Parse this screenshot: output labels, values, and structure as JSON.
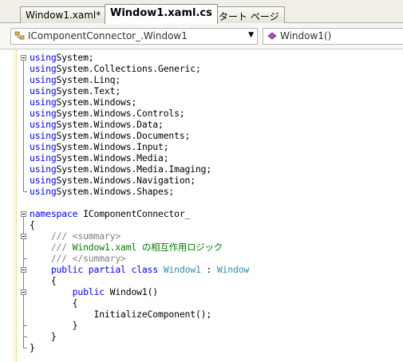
{
  "tabs": [
    {
      "label": "Window1.xaml*",
      "active": false
    },
    {
      "label": "Window1.xaml.cs",
      "active": true
    },
    {
      "label": "スタート ページ",
      "active": false
    }
  ],
  "nav": {
    "class_combo": "IComponentConnector_.Window1",
    "member_combo": "Window1()"
  },
  "code": [
    [
      [
        "kw",
        "using"
      ],
      [
        "",
        "System;"
      ]
    ],
    [
      [
        "kw",
        "using"
      ],
      [
        "",
        "System.Collections.Generic;"
      ]
    ],
    [
      [
        "kw",
        "using"
      ],
      [
        "",
        "System.Linq;"
      ]
    ],
    [
      [
        "kw",
        "using"
      ],
      [
        "",
        "System.Text;"
      ]
    ],
    [
      [
        "kw",
        "using"
      ],
      [
        "",
        "System.Windows;"
      ]
    ],
    [
      [
        "kw",
        "using"
      ],
      [
        "",
        "System.Windows.Controls;"
      ]
    ],
    [
      [
        "kw",
        "using"
      ],
      [
        "",
        "System.Windows.Data;"
      ]
    ],
    [
      [
        "kw",
        "using"
      ],
      [
        "",
        "System.Windows.Documents;"
      ]
    ],
    [
      [
        "kw",
        "using"
      ],
      [
        "",
        "System.Windows.Input;"
      ]
    ],
    [
      [
        "kw",
        "using"
      ],
      [
        "",
        "System.Windows.Media;"
      ]
    ],
    [
      [
        "kw",
        "using"
      ],
      [
        "",
        "System.Windows.Media.Imaging;"
      ]
    ],
    [
      [
        "kw",
        "using"
      ],
      [
        "",
        "System.Windows.Navigation;"
      ]
    ],
    [
      [
        "kw",
        "using"
      ],
      [
        "",
        "System.Windows.Shapes;"
      ]
    ],
    [],
    [
      [
        "kw",
        "namespace"
      ],
      [
        "",
        " IComponentConnector_"
      ]
    ],
    [
      [
        "",
        "{"
      ]
    ],
    [
      [
        "dc",
        "    /// <summary>"
      ]
    ],
    [
      [
        "dc",
        "    ///"
      ],
      [
        "cm",
        " Window1.xaml の相互作用ロジック"
      ]
    ],
    [
      [
        "dc",
        "    /// </summary>"
      ]
    ],
    [
      [
        "kw",
        "    public"
      ],
      [
        "",
        " "
      ],
      [
        "kw",
        "partial"
      ],
      [
        "",
        " "
      ],
      [
        "kw",
        "class"
      ],
      [
        "",
        " "
      ],
      [
        "ty",
        "Window1"
      ],
      [
        "",
        " : "
      ],
      [
        "ty",
        "Window"
      ]
    ],
    [
      [
        "",
        "    {"
      ]
    ],
    [
      [
        "kw",
        "        public"
      ],
      [
        "",
        " Window1()"
      ]
    ],
    [
      [
        "",
        "        {"
      ]
    ],
    [
      [
        "",
        "            InitializeComponent();"
      ]
    ],
    [
      [
        "",
        "        }"
      ]
    ],
    [
      [
        "",
        "    }"
      ]
    ],
    [
      [
        "",
        "}"
      ]
    ]
  ]
}
